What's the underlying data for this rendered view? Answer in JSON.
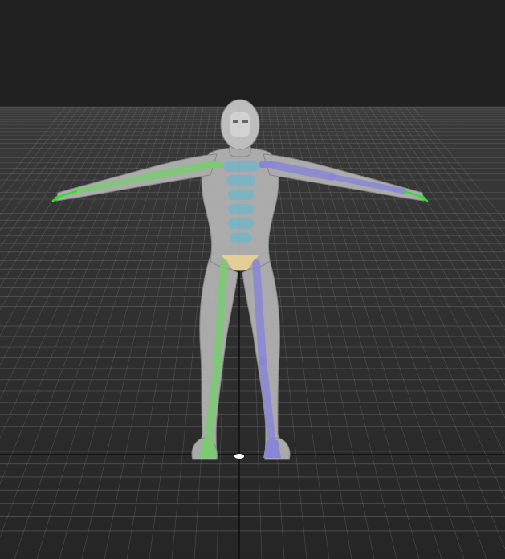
{
  "viewport": {
    "label": "",
    "background_color": "#212121",
    "floor_color": "#2e2e2e",
    "grid_color": "#8a8a8a",
    "axis_color": "#0d0d0d"
  },
  "character": {
    "name": "",
    "mesh_color": "#b4b4b4",
    "head_color": "#c8c8c8",
    "left_limb_bone_color": "#7ccb74",
    "right_limb_bone_color": "#8a86d6",
    "spine_bone_color": "#74b5c4",
    "pelvis_bone_color": "#e3cf95",
    "hand_helper_color": "#2fe02f"
  },
  "pivot": {
    "icon": "pivot-point-icon",
    "color": "#ffffff"
  }
}
